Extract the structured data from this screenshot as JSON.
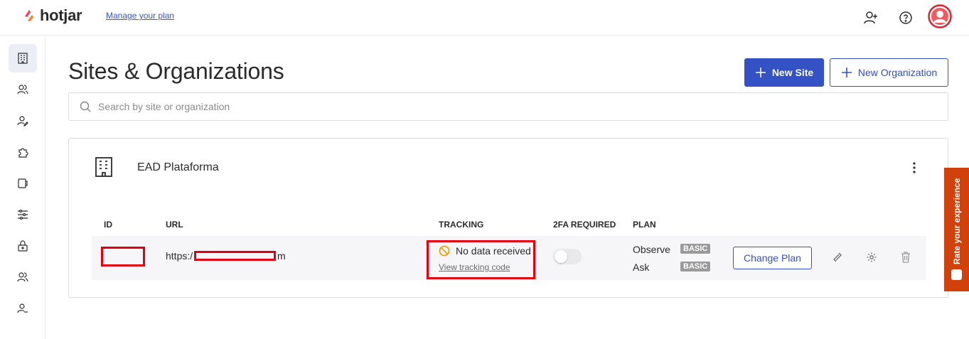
{
  "topbar": {
    "logo_text": "hotjar",
    "manage_link": "Manage your plan",
    "icons": [
      "add-user-icon",
      "help-icon",
      "avatar"
    ]
  },
  "sidebar": {
    "items": [
      {
        "icon": "building-icon",
        "active": true
      },
      {
        "icon": "users-icon",
        "active": false
      },
      {
        "icon": "user-edit-icon",
        "active": false
      },
      {
        "icon": "puzzle-icon",
        "active": false
      },
      {
        "icon": "device-icon",
        "active": false
      },
      {
        "icon": "sliders-icon",
        "active": false
      },
      {
        "icon": "lock-icon",
        "active": false
      },
      {
        "icon": "team-icon",
        "active": false
      },
      {
        "icon": "user-settings-icon",
        "active": false
      }
    ]
  },
  "main": {
    "title": "Sites & Organizations",
    "new_site_label": "New Site",
    "new_org_label": "New Organization",
    "search_placeholder": "Search by site or organization"
  },
  "organization": {
    "name": "EAD Plataforma",
    "columns": [
      "ID",
      "URL",
      "TRACKING",
      "2FA REQUIRED",
      "PLAN"
    ],
    "site": {
      "id": "",
      "url_prefix": "https:/",
      "url_suffix": "m",
      "tracking_status": "No data received",
      "tracking_link": "View tracking code",
      "two_fa_enabled": false,
      "plans": [
        {
          "name": "Observe",
          "tier": "BASIC"
        },
        {
          "name": "Ask",
          "tier": "BASIC"
        }
      ],
      "change_plan_label": "Change Plan"
    }
  },
  "feedback_tab": {
    "label": "Rate your experience"
  },
  "colors": {
    "accent": "#3451c6",
    "brand_orange": "#fd3a5c",
    "redaction": "#e3000f",
    "warning": "#f0a000",
    "feedback_tab": "#d1410c"
  }
}
